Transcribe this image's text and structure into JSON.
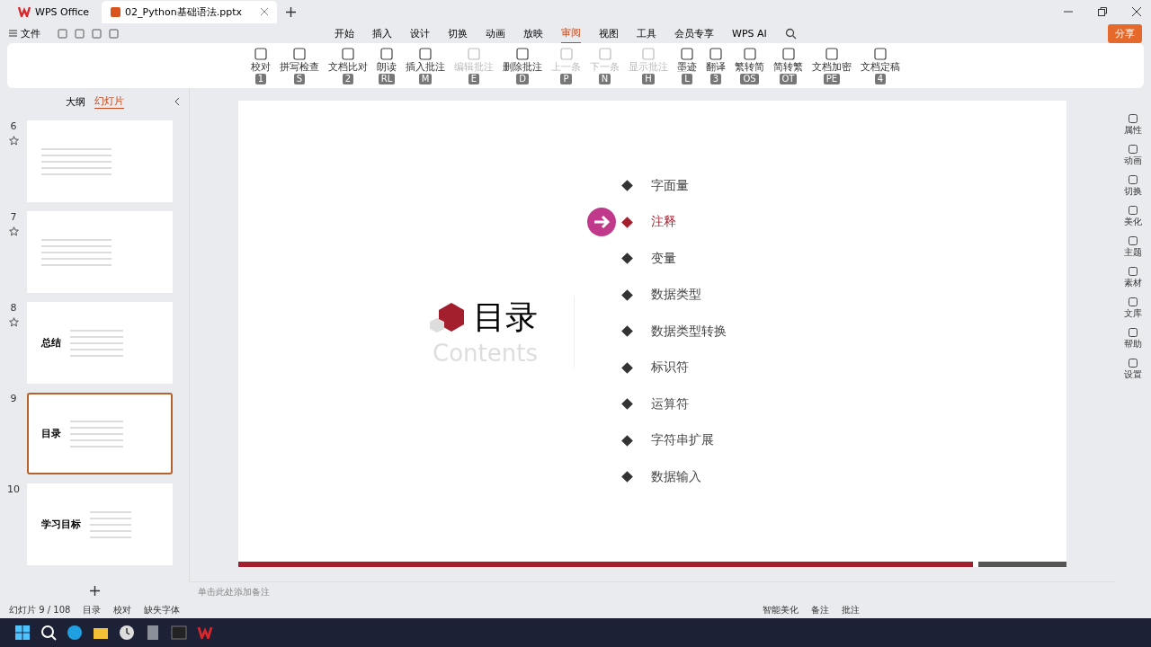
{
  "app_tabs": [
    {
      "label": "WPS Office",
      "selected": false
    },
    {
      "label": "02_Python基础语法.pptx",
      "selected": true
    }
  ],
  "menu": {
    "file": "文件",
    "tabs": [
      {
        "label": "开始",
        "selected": false
      },
      {
        "label": "插入",
        "selected": false
      },
      {
        "label": "设计",
        "selected": false
      },
      {
        "label": "切换",
        "selected": false
      },
      {
        "label": "动画",
        "selected": false
      },
      {
        "label": "放映",
        "selected": false
      },
      {
        "label": "审阅",
        "selected": true
      },
      {
        "label": "视图",
        "selected": false
      },
      {
        "label": "工具",
        "selected": false
      },
      {
        "label": "会员专享",
        "selected": false
      },
      {
        "label": "WPS AI",
        "selected": false
      }
    ],
    "share": "分享"
  },
  "ribbon": [
    {
      "label": "校对",
      "key": "1",
      "disabled": false
    },
    {
      "label": "拼写检查",
      "key": "S",
      "disabled": false
    },
    {
      "label": "文档比对",
      "key": "2",
      "disabled": false
    },
    {
      "label": "朗读",
      "key": "RL",
      "disabled": false
    },
    {
      "label": "插入批注",
      "key": "M",
      "disabled": false
    },
    {
      "label": "编辑批注",
      "key": "E",
      "disabled": true
    },
    {
      "label": "删除批注",
      "key": "D",
      "disabled": false
    },
    {
      "label": "上一条",
      "key": "P",
      "disabled": true
    },
    {
      "label": "下一条",
      "key": "N",
      "disabled": true
    },
    {
      "label": "显示批注",
      "key": "H",
      "disabled": true
    },
    {
      "label": "墨迹",
      "key": "L",
      "disabled": false
    },
    {
      "label": "翻译",
      "key": "3",
      "disabled": false
    },
    {
      "label": "繁转简",
      "key": "OS",
      "disabled": false
    },
    {
      "label": "简转繁",
      "key": "OT",
      "disabled": false
    },
    {
      "label": "文档加密",
      "key": "PE",
      "disabled": false
    },
    {
      "label": "文档定稿",
      "key": "4",
      "disabled": false
    }
  ],
  "panel": {
    "tabs": [
      {
        "label": "大纲",
        "selected": false
      },
      {
        "label": "幻灯片",
        "selected": true
      }
    ],
    "slides": [
      {
        "number": "6",
        "selected": false,
        "starred": true
      },
      {
        "number": "7",
        "selected": false,
        "starred": true
      },
      {
        "number": "8",
        "title": "总结",
        "selected": false,
        "starred": true
      },
      {
        "number": "9",
        "title": "目录",
        "selected": true,
        "starred": false
      },
      {
        "number": "10",
        "title": "学习目标",
        "selected": false,
        "starred": false
      }
    ]
  },
  "slide": {
    "title": "目录",
    "subtitle": "Contents",
    "items": [
      {
        "label": "字面量",
        "selected": false
      },
      {
        "label": "注释",
        "selected": true
      },
      {
        "label": "变量",
        "selected": false
      },
      {
        "label": "数据类型",
        "selected": false
      },
      {
        "label": "数据类型转换",
        "selected": false
      },
      {
        "label": "标识符",
        "selected": false
      },
      {
        "label": "运算符",
        "selected": false
      },
      {
        "label": "字符串扩展",
        "selected": false
      },
      {
        "label": "数据输入",
        "selected": false
      }
    ]
  },
  "notes": {
    "placeholder": "单击此处添加备注"
  },
  "sidebar": [
    "属性",
    "动画",
    "切换",
    "美化",
    "主题",
    "素材",
    "文库",
    "帮助",
    "设置"
  ],
  "status_bar": {
    "slide_count": "幻灯片 9 / 108",
    "items": [
      "目录",
      "校对",
      "缺失字体"
    ],
    "right": [
      "智能美化",
      "备注",
      "批注"
    ]
  }
}
